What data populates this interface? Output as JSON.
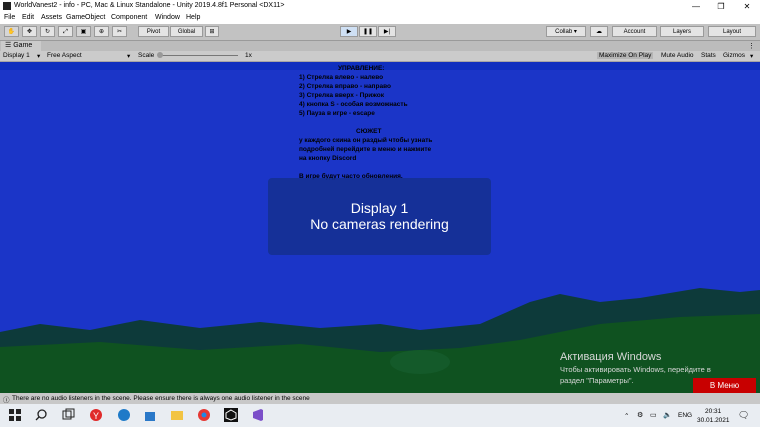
{
  "window": {
    "title": "WorldVanest2 - info - PC, Mac & Linux Standalone - Unity 2019.4.8f1 Personal <DX11>",
    "minimize": "—",
    "maximize": "❐",
    "close": "✕"
  },
  "menubar": {
    "items": [
      "File",
      "Edit",
      "Assets",
      "GameObject",
      "Component",
      "Window",
      "Help"
    ]
  },
  "toolbar": {
    "pivot": "Pivot",
    "global": "Global",
    "collab": "Collab ▾",
    "account": "Account",
    "layers": "Layers",
    "layout": "Layout"
  },
  "game_panel": {
    "tab": "Game",
    "display": "Display 1",
    "aspect": "Free Aspect",
    "scale_label": "Scale",
    "scale_value": "1x",
    "maximize_on_play": "Maximize On Play",
    "mute_audio": "Mute Audio",
    "stats": "Stats",
    "gizmos": "Gizmos"
  },
  "game": {
    "heading": "УПРАВЛЕНИЕ:",
    "controls": [
      "1) Стрелка влево - налево",
      "2) Стрелка вправо - направо",
      "3) Стрелка вверх - Прижок",
      "4) кнопка S - особая возможнасть",
      "5) Пауза в игре - escape"
    ],
    "story_heading": "СЮЖЕТ",
    "story": [
      "у каждого скина он раздый чтобы узнать",
      "подробней перейдите в меню и нажмите",
      "на кнопку Discord"
    ],
    "updates": "В игре будут часто обновления.",
    "overlay_line1": "Display 1",
    "overlay_line2": "No cameras rendering",
    "activation_title": "Активация Windows",
    "activation_line1": "Чтобы активировать Windows, перейдите в",
    "activation_line2": "раздел \"Параметры\".",
    "menu_button": "В Меню"
  },
  "status": {
    "message": "There are no audio listeners in the scene. Please ensure there is always one audio listener in the scene"
  },
  "taskbar": {
    "lang": "ENG",
    "time": "20:31",
    "date": "30.01.2021"
  },
  "colors": {
    "game_bg": "#1b35c8",
    "menu_btn": "#c80000"
  }
}
